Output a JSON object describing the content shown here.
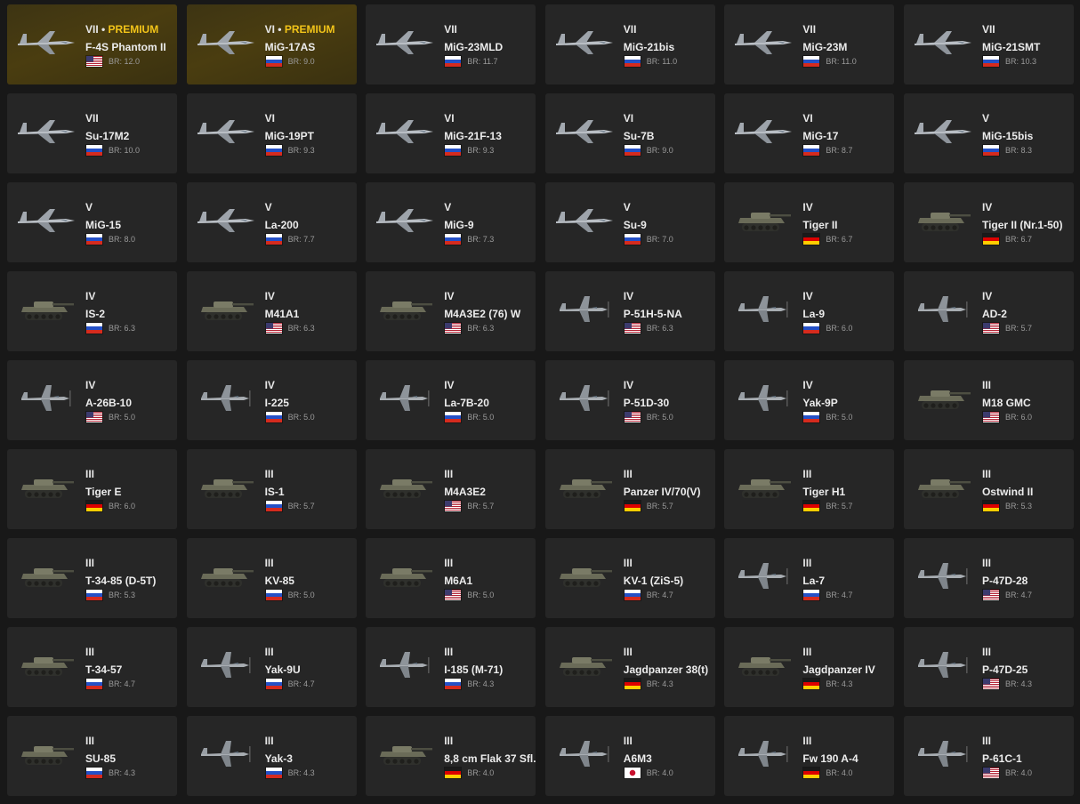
{
  "br_prefix": "BR:",
  "premium_label": "PREMIUM",
  "vehicles": [
    {
      "tier": "VII",
      "premium": true,
      "name": "F-4S Phantom II",
      "nation": "usa",
      "br": "12.0",
      "type": "jet"
    },
    {
      "tier": "VI",
      "premium": true,
      "name": "MiG-17AS",
      "nation": "ussr",
      "br": "9.0",
      "type": "jet"
    },
    {
      "tier": "VII",
      "name": "MiG-23MLD",
      "nation": "ussr",
      "br": "11.7",
      "type": "jet"
    },
    {
      "tier": "VII",
      "name": "MiG-21bis",
      "nation": "ussr",
      "br": "11.0",
      "type": "jet"
    },
    {
      "tier": "VII",
      "name": "MiG-23M",
      "nation": "ussr",
      "br": "11.0",
      "type": "jet"
    },
    {
      "tier": "VII",
      "name": "MiG-21SMT",
      "nation": "ussr",
      "br": "10.3",
      "type": "jet"
    },
    {
      "tier": "VII",
      "name": "Su-17M2",
      "nation": "ussr",
      "br": "10.0",
      "type": "jet"
    },
    {
      "tier": "VI",
      "name": "MiG-19PT",
      "nation": "ussr",
      "br": "9.3",
      "type": "jet"
    },
    {
      "tier": "VI",
      "name": "MiG-21F-13",
      "nation": "ussr",
      "br": "9.3",
      "type": "jet"
    },
    {
      "tier": "VI",
      "name": "Su-7B",
      "nation": "ussr",
      "br": "9.0",
      "type": "jet"
    },
    {
      "tier": "VI",
      "name": "MiG-17",
      "nation": "ussr",
      "br": "8.7",
      "type": "jet"
    },
    {
      "tier": "V",
      "name": "MiG-15bis",
      "nation": "ussr",
      "br": "8.3",
      "type": "jet"
    },
    {
      "tier": "V",
      "name": "MiG-15",
      "nation": "ussr",
      "br": "8.0",
      "type": "jet"
    },
    {
      "tier": "V",
      "name": "La-200",
      "nation": "ussr",
      "br": "7.7",
      "type": "jet"
    },
    {
      "tier": "V",
      "name": "MiG-9",
      "nation": "ussr",
      "br": "7.3",
      "type": "jet"
    },
    {
      "tier": "V",
      "name": "Su-9",
      "nation": "ussr",
      "br": "7.0",
      "type": "jet"
    },
    {
      "tier": "IV",
      "name": "Tiger II",
      "nation": "germany",
      "br": "6.7",
      "type": "tank"
    },
    {
      "tier": "IV",
      "name": "Tiger II (Nr.1-50)",
      "nation": "germany",
      "br": "6.7",
      "type": "tank"
    },
    {
      "tier": "IV",
      "name": "IS-2",
      "nation": "ussr",
      "br": "6.3",
      "type": "tank"
    },
    {
      "tier": "IV",
      "name": "M41A1",
      "nation": "usa",
      "br": "6.3",
      "type": "tank"
    },
    {
      "tier": "IV",
      "name": "M4A3E2 (76) W",
      "nation": "usa",
      "br": "6.3",
      "type": "tank"
    },
    {
      "tier": "IV",
      "name": "P-51H-5-NA",
      "nation": "usa",
      "br": "6.3",
      "type": "prop"
    },
    {
      "tier": "IV",
      "name": "La-9",
      "nation": "ussr",
      "br": "6.0",
      "type": "prop"
    },
    {
      "tier": "IV",
      "name": "AD-2",
      "nation": "usa",
      "br": "5.7",
      "type": "prop"
    },
    {
      "tier": "IV",
      "name": "A-26B-10",
      "nation": "usa",
      "br": "5.0",
      "type": "prop"
    },
    {
      "tier": "IV",
      "name": "I-225",
      "nation": "ussr",
      "br": "5.0",
      "type": "prop"
    },
    {
      "tier": "IV",
      "name": "La-7B-20",
      "nation": "ussr",
      "br": "5.0",
      "type": "prop"
    },
    {
      "tier": "IV",
      "name": "P-51D-30",
      "nation": "usa",
      "br": "5.0",
      "type": "prop"
    },
    {
      "tier": "IV",
      "name": "Yak-9P",
      "nation": "ussr",
      "br": "5.0",
      "type": "prop"
    },
    {
      "tier": "III",
      "name": "M18 GMC",
      "nation": "usa",
      "br": "6.0",
      "type": "tank"
    },
    {
      "tier": "III",
      "name": "Tiger E",
      "nation": "germany",
      "br": "6.0",
      "type": "tank"
    },
    {
      "tier": "III",
      "name": "IS-1",
      "nation": "ussr",
      "br": "5.7",
      "type": "tank"
    },
    {
      "tier": "III",
      "name": "M4A3E2",
      "nation": "usa",
      "br": "5.7",
      "type": "tank"
    },
    {
      "tier": "III",
      "name": "Panzer IV/70(V)",
      "nation": "germany",
      "br": "5.7",
      "type": "tank"
    },
    {
      "tier": "III",
      "name": "Tiger H1",
      "nation": "germany",
      "br": "5.7",
      "type": "tank"
    },
    {
      "tier": "III",
      "name": "Ostwind II",
      "nation": "germany",
      "br": "5.3",
      "type": "tank"
    },
    {
      "tier": "III",
      "name": "T-34-85 (D-5T)",
      "nation": "ussr",
      "br": "5.3",
      "type": "tank"
    },
    {
      "tier": "III",
      "name": "KV-85",
      "nation": "ussr",
      "br": "5.0",
      "type": "tank"
    },
    {
      "tier": "III",
      "name": "M6A1",
      "nation": "usa",
      "br": "5.0",
      "type": "tank"
    },
    {
      "tier": "III",
      "name": "KV-1 (ZiS-5)",
      "nation": "ussr",
      "br": "4.7",
      "type": "tank"
    },
    {
      "tier": "III",
      "name": "La-7",
      "nation": "ussr",
      "br": "4.7",
      "type": "prop"
    },
    {
      "tier": "III",
      "name": "P-47D-28",
      "nation": "usa",
      "br": "4.7",
      "type": "prop"
    },
    {
      "tier": "III",
      "name": "T-34-57",
      "nation": "ussr",
      "br": "4.7",
      "type": "tank"
    },
    {
      "tier": "III",
      "name": "Yak-9U",
      "nation": "ussr",
      "br": "4.7",
      "type": "prop"
    },
    {
      "tier": "III",
      "name": "I-185 (M-71)",
      "nation": "ussr",
      "br": "4.3",
      "type": "prop"
    },
    {
      "tier": "III",
      "name": "Jagdpanzer 38(t)",
      "nation": "germany",
      "br": "4.3",
      "type": "tank"
    },
    {
      "tier": "III",
      "name": "Jagdpanzer IV",
      "nation": "germany",
      "br": "4.3",
      "type": "tank"
    },
    {
      "tier": "III",
      "name": "P-47D-25",
      "nation": "usa",
      "br": "4.3",
      "type": "prop"
    },
    {
      "tier": "III",
      "name": "SU-85",
      "nation": "ussr",
      "br": "4.3",
      "type": "tank"
    },
    {
      "tier": "III",
      "name": "Yak-3",
      "nation": "ussr",
      "br": "4.3",
      "type": "prop"
    },
    {
      "tier": "III",
      "name": "8,8 cm Flak 37 Sfl.",
      "nation": "germany",
      "br": "4.0",
      "type": "tank"
    },
    {
      "tier": "III",
      "name": "A6M3",
      "nation": "japan",
      "br": "4.0",
      "type": "prop"
    },
    {
      "tier": "III",
      "name": "Fw 190 A-4",
      "nation": "germany",
      "br": "4.0",
      "type": "prop"
    },
    {
      "tier": "III",
      "name": "P-61C-1",
      "nation": "usa",
      "br": "4.0",
      "type": "prop"
    }
  ],
  "colors": {
    "card_bg": "#262626",
    "page_bg": "#181818",
    "premium_text": "#f2c419"
  }
}
